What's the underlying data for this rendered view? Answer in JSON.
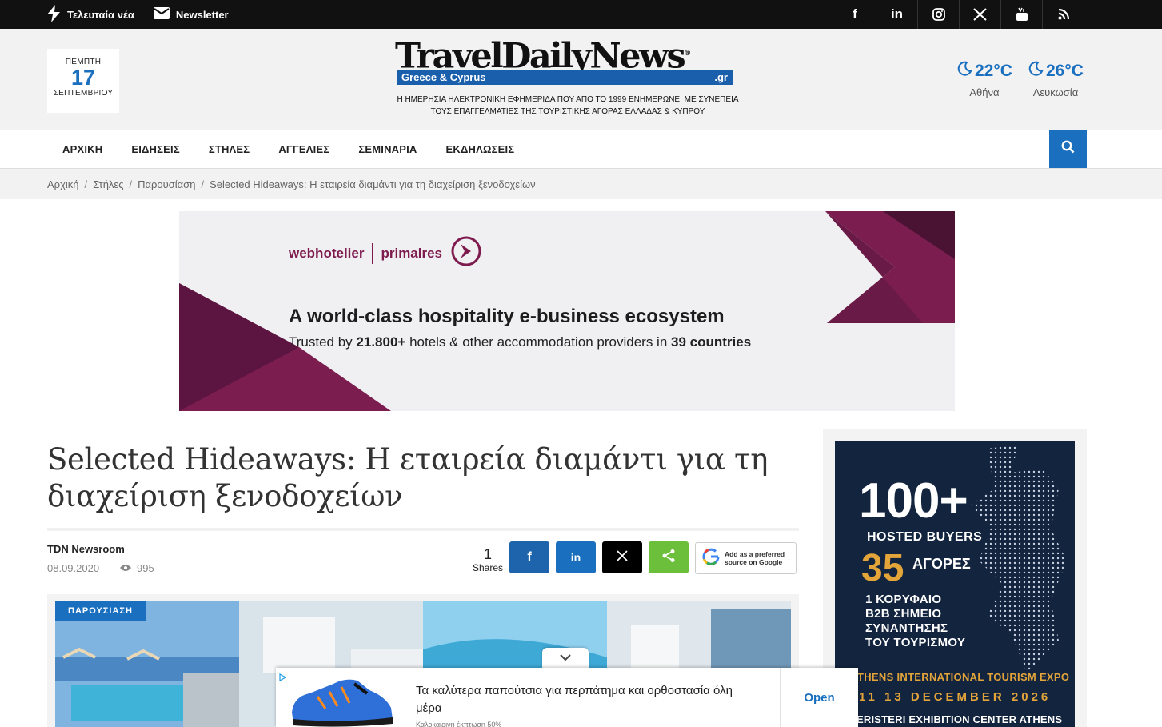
{
  "topbar": {
    "latest_label": "Τελευταία νέα",
    "newsletter_label": "Newsletter",
    "social": [
      {
        "name": "facebook-icon",
        "glyph": "f"
      },
      {
        "name": "linkedin-icon",
        "glyph": "in"
      },
      {
        "name": "instagram-icon",
        "glyph": ""
      },
      {
        "name": "x-icon",
        "glyph": ""
      },
      {
        "name": "youtube-icon",
        "glyph": ""
      },
      {
        "name": "rss-icon",
        "glyph": ""
      }
    ]
  },
  "header": {
    "date": {
      "weekday": "ΠΕΜΠΤΗ",
      "day": "17",
      "month": "ΣΕΠΤΕΜΒΡΙΟΥ"
    },
    "logo": {
      "word": "TravelDailyNews",
      "sub": "Greece & Cyprus",
      "domain": ".gr",
      "reg": "®"
    },
    "tagline": "Η ΗΜΕΡΗΣΙΑ ΗΛΕΚΤΡΟΝΙΚΗ ΕΦΗΜΕΡΙΔΑ ΠΟΥ ΑΠΟ ΤΟ 1999 ΕΝΗΜΕΡΩΝΕΙ ΜΕ ΣΥΝΕΠΕΙΑ ΤΟΥΣ ΕΠΑΓΓΕΛΜΑΤΙΕΣ ΤΗΣ ΤΟΥΡΙΣΤΙΚΗΣ ΑΓΟΡΑΣ ΕΛΛΑΔΑΣ & ΚΥΠΡΟΥ",
    "weather": [
      {
        "temp": "22°C",
        "city": "Αθήνα"
      },
      {
        "temp": "26°C",
        "city": "Λευκωσία"
      }
    ]
  },
  "nav": {
    "items": [
      "ΑΡΧΙΚΗ",
      "ΕΙΔΗΣΕΙΣ",
      "ΣΤΗΛΕΣ",
      "ΑΓΓΕΛΙΕΣ",
      "ΣΕΜΙΝΑΡΙΑ",
      "ΕΚΔΗΛΩΣΕΙΣ"
    ]
  },
  "breadcrumb": [
    "Αρχική",
    "Στήλες",
    "Παρουσίαση",
    "Selected Hideaways: Η εταιρεία διαμάντι για τη διαχείριση ξενοδοχείων"
  ],
  "banner": {
    "brand1": "webhotelier",
    "brand2": "primalres",
    "headline": "A world-class hospitality e-business ecosystem",
    "sub_pre": "Trusted by ",
    "sub_b1": "21.800+",
    "sub_mid": " hotels & other accommodation providers in ",
    "sub_b2": "39 countries"
  },
  "article": {
    "title": "Selected Hideaways: Η εταιρεία διαμάντι για τη διαχείριση ξενοδοχείων",
    "author": "TDN Newsroom",
    "date": "08.09.2020",
    "views": "995",
    "shares_count": "1",
    "shares_label": "Shares",
    "google_line1": "Add as a preferred",
    "google_line2": "source on Google",
    "tag": "ΠΑΡΟΥΣΙΑΣΗ"
  },
  "sidebar_ad": {
    "big": "100+",
    "hosted": "HOSTED BUYERS",
    "num": "35",
    "agores": "ΑΓΟΡΕΣ",
    "line1": "1 ΚΟΡΥΦΑΙΟ",
    "line2": "B2B ΣΗΜΕΙΟ",
    "line3": "ΣΥΝΑΝΤΗΣΗΣ",
    "line4": "ΤΟΥ ΤΟΥΡΙΣΜΟΥ",
    "expo": "THENS INTERNATIONAL TOURISM EXPO",
    "dates": "11 13 DECEMBER 2026",
    "venue": "ERISTERI EXHIBITION CENTER ATHENS"
  },
  "bottom_ad": {
    "text": "Τα καλύτερα παπούτσια για περπάτημα και ορθοστασία όλη μέρα",
    "small": "Καλοκαιρινή έκπτωση 50%",
    "cta": "Open"
  },
  "colors": {
    "accent": "#1a6fbf",
    "topbar": "#111111",
    "facebook": "#1d64ad",
    "linkedin": "#1a6fbf",
    "x": "#000000",
    "share": "#6cbf3a",
    "banner_brand": "#7d1a4e",
    "expo_gold": "#e3a43a",
    "expo_navy": "#13243f"
  }
}
